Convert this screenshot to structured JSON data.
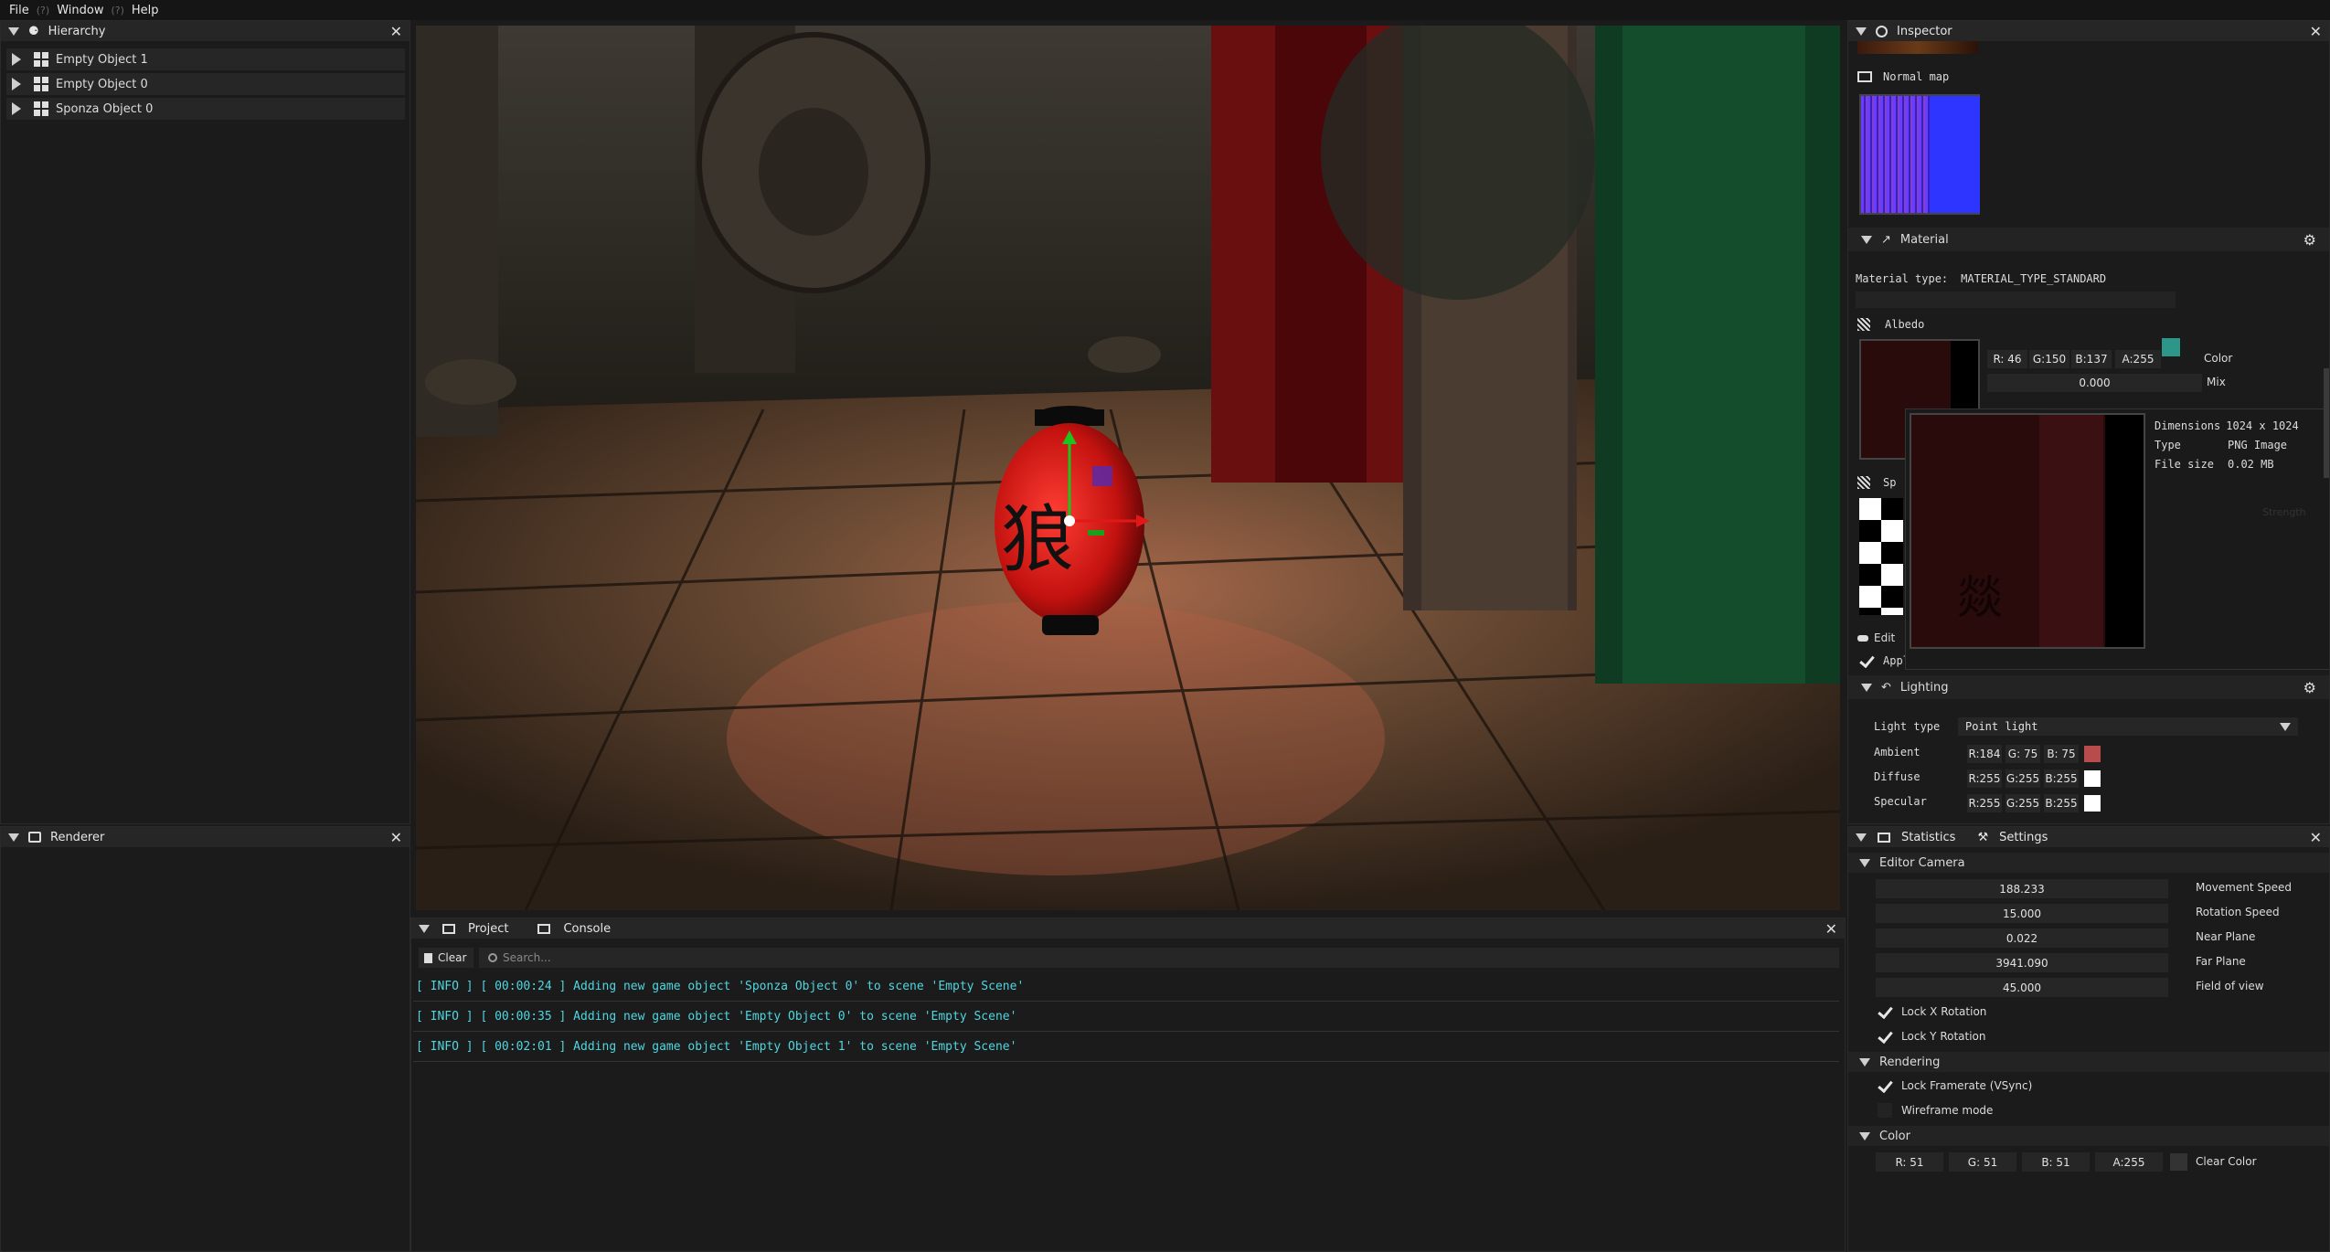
{
  "menu": {
    "file": "File",
    "window": "Window",
    "help": "Help",
    "placeholder": "(?)"
  },
  "hierarchy": {
    "title": "Hierarchy",
    "items": [
      {
        "label": "Empty Object 1"
      },
      {
        "label": "Empty Object 0"
      },
      {
        "label": "Sponza Object 0"
      }
    ]
  },
  "renderer": {
    "title": "Renderer"
  },
  "viewport": {
    "lantern_glyph": "狼"
  },
  "bottom": {
    "tabs": [
      "Project",
      "Console"
    ],
    "clear_label": "Clear",
    "search_placeholder": "Search...",
    "logs": [
      "[ INFO ] [ 00:00:24 ] Adding new game object 'Sponza Object 0' to scene 'Empty Scene'",
      "[ INFO ] [ 00:00:35 ] Adding new game object 'Empty Object 0' to scene 'Empty Scene'",
      "[ INFO ] [ 00:02:01 ] Adding new game object 'Empty Object 1' to scene 'Empty Scene'"
    ]
  },
  "inspector": {
    "title": "Inspector",
    "normal_map_label": "Normal map",
    "material": {
      "title": "Material",
      "type_label": "Material type:",
      "type_value": "MATERIAL_TYPE_STANDARD",
      "albedo_label": "Albedo",
      "rgba": {
        "r": "R: 46",
        "g": "G:150",
        "b": "B:137",
        "a": "A:255"
      },
      "color_label": "Color",
      "albedo_color": "#2e9689",
      "mix_value": "0.000",
      "mix_label": "Mix",
      "specular_label": "Sp",
      "edit_label": "Edit",
      "apply_label": "Apply material",
      "tooltip": {
        "dim_label": "Dimensions",
        "dim_value": "1024 x 1024",
        "type_label": "Type",
        "type_value": "PNG Image",
        "size_label": "File size",
        "size_value": "0.02 MB",
        "ghost": "Strength",
        "glyph": "燚"
      }
    },
    "lighting": {
      "title": "Lighting",
      "light_type_label": "Light type",
      "light_type_value": "Point light",
      "rows": [
        {
          "label": "Ambient",
          "r": "R:184",
          "g": "G: 75",
          "b": "B: 75",
          "color": "#b84b4b"
        },
        {
          "label": "Diffuse",
          "r": "R:255",
          "g": "G:255",
          "b": "B:255",
          "color": "#ffffff"
        },
        {
          "label": "Specular",
          "r": "R:255",
          "g": "G:255",
          "b": "B:255",
          "color": "#ffffff"
        }
      ]
    }
  },
  "stats": {
    "tabs": [
      "Statistics",
      "Settings"
    ],
    "editor_camera": "Editor Camera",
    "fields": [
      {
        "value": "188.233",
        "label": "Movement Speed"
      },
      {
        "value": "15.000",
        "label": "Rotation Speed"
      },
      {
        "value": "0.022",
        "label": "Near Plane"
      },
      {
        "value": "3941.090",
        "label": "Far Plane"
      },
      {
        "value": "45.000",
        "label": "Field of view"
      }
    ],
    "lock_x": "Lock X Rotation",
    "lock_y": "Lock Y Rotation",
    "rendering": "Rendering",
    "vsync": "Lock Framerate (VSync)",
    "wireframe": "Wireframe mode",
    "color": "Color",
    "clear": {
      "r": "R: 51",
      "g": "G: 51",
      "b": "B: 51",
      "a": "A:255",
      "label": "Clear Color"
    }
  }
}
